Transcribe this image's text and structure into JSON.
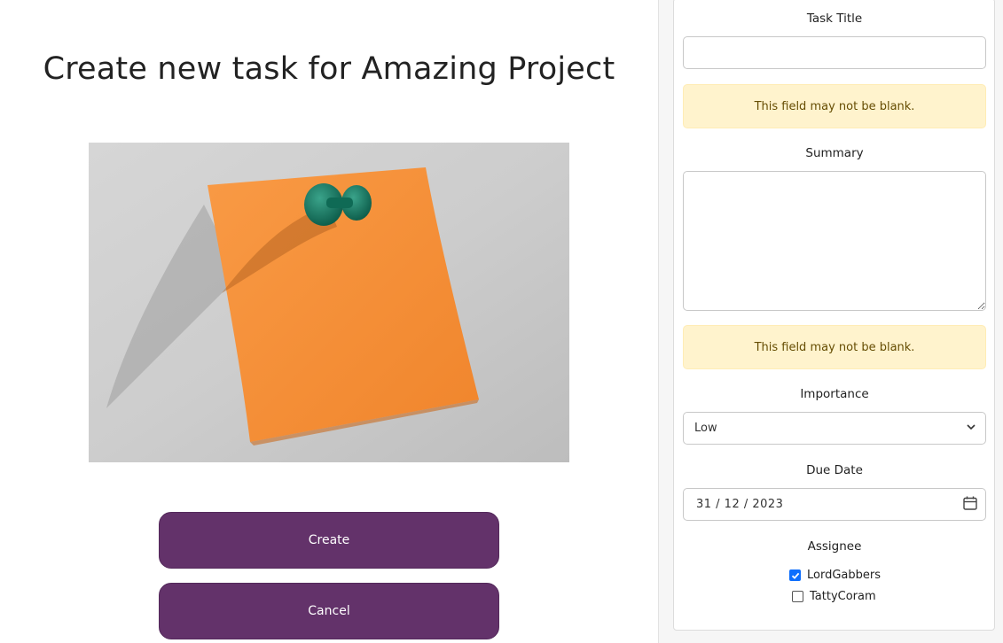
{
  "page": {
    "title": "Create new task for Amazing Project"
  },
  "actions": {
    "create_label": "Create",
    "cancel_label": "Cancel"
  },
  "form": {
    "task_title": {
      "label": "Task Title",
      "value": "",
      "error": "This field may not be blank."
    },
    "summary": {
      "label": "Summary",
      "value": "",
      "error": "This field may not be blank."
    },
    "importance": {
      "label": "Importance",
      "selected": "Low"
    },
    "due_date": {
      "label": "Due Date",
      "value": "31 / 12 / 2023"
    },
    "assignee": {
      "label": "Assignee",
      "options": [
        {
          "name": "LordGabbers",
          "checked": true
        },
        {
          "name": "TattyCoram",
          "checked": false
        }
      ]
    }
  },
  "colors": {
    "button": "#63326a",
    "alert_bg": "#fff3cd",
    "alert_text": "#664d03",
    "note": "#f7923a"
  },
  "icons": {
    "photo": "sticky-note-pushpin",
    "select": "chevron-down-icon",
    "date": "calendar-icon",
    "check": "checkmark-icon"
  }
}
